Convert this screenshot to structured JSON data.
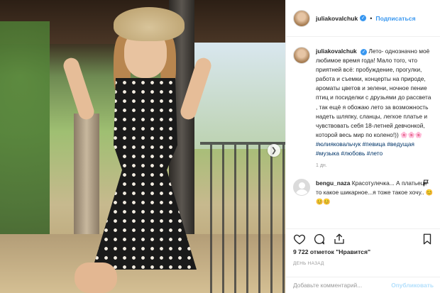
{
  "post": {
    "username": "juliakovalchuk",
    "follow_label": "Подписаться",
    "separator": "•",
    "caption_text": "Лето- однозначно моё любимое время года! Мало того, что приятней всё: пробуждение, прогулки, работа и съемки, концерты на природе, ароматы цветов и зелени, ночное пение птиц и посиделки с друзьями до рассвета , так ещё я обожаю лето за возможность надеть шляпку, сланцы, легкое платье и чувствовать себя 18-летней девчонкой, которой весь мир по колено!)) 🌸🌸🌸",
    "hashtags": "#юлияковальчук #певица #ведущая #музыка #любовь #лето",
    "caption_time": "1 дн.",
    "likes": "9 722 отметок \"Нравится\"",
    "date": "ДЕНЬ НАЗАД"
  },
  "comments": [
    {
      "username": "bengu_naza",
      "text": "Красотулечка... А платьеце то какое шикарное...я тоже такое хочу.. 😊😊😊"
    }
  ],
  "add_comment": {
    "placeholder": "Добавьте комментарий...",
    "publish_label": "Опубликовать"
  },
  "icons": {
    "like": "heart-icon",
    "comment": "comment-icon",
    "share": "share-icon",
    "save": "bookmark-icon",
    "next": "chevron-right-icon",
    "verified": "verified-badge-icon",
    "report": "flag-icon"
  },
  "colors": {
    "accent": "#3897f0",
    "hashtag": "#003569",
    "muted": "#999999"
  }
}
